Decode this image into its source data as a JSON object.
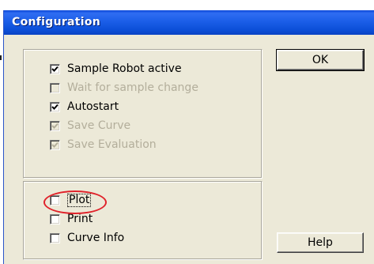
{
  "window": {
    "title": "Configuration"
  },
  "options_group": {
    "items": [
      {
        "label": "Sample Robot active",
        "checked": true,
        "enabled": true
      },
      {
        "label": "Wait for sample change",
        "checked": false,
        "enabled": false
      },
      {
        "label": "Autostart",
        "checked": true,
        "enabled": true
      },
      {
        "label": "Save Curve",
        "checked": true,
        "enabled": false
      },
      {
        "label": "Save Evaluation",
        "checked": true,
        "enabled": false
      }
    ]
  },
  "output_group": {
    "items": [
      {
        "label": "Plot",
        "checked": false,
        "enabled": true
      },
      {
        "label": "Print",
        "checked": false,
        "enabled": true
      },
      {
        "label": "Curve Info",
        "checked": false,
        "enabled": true
      }
    ]
  },
  "buttons": {
    "ok_label": "OK",
    "help_label": "Help"
  },
  "colors": {
    "titlebar": "#0a47d8",
    "dialog_bg": "#ece9d8",
    "disabled_text": "#b3ae9b",
    "highlight": "#e0222a"
  }
}
